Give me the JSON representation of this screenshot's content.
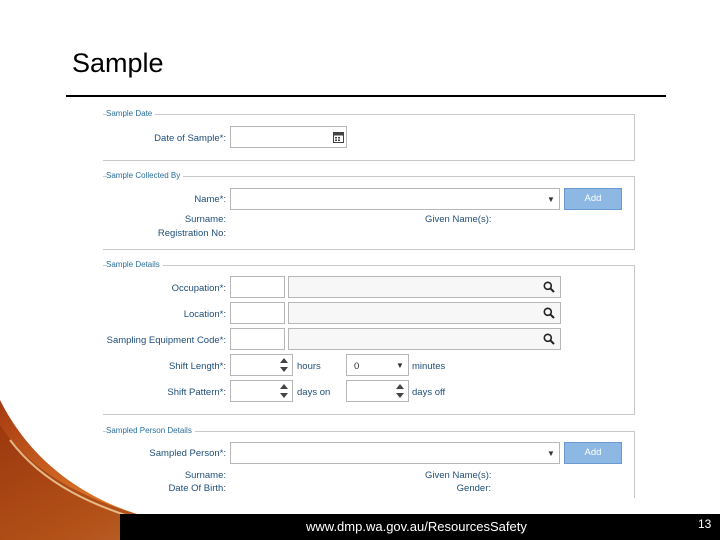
{
  "slide": {
    "title": "Sample",
    "footer_url": "www.dmp.wa.gov.au/ResourcesSafety",
    "page_number": "13"
  },
  "sections": {
    "sample_date": {
      "legend": "Sample Date",
      "date_label": "Date of Sample*:"
    },
    "collected_by": {
      "legend": "Sample Collected By",
      "name_label": "Name*:",
      "add_label": "Add",
      "surname_label": "Surname:",
      "given_label": "Given Name(s):",
      "registration_label": "Registration No:"
    },
    "details": {
      "legend": "Sample Details",
      "occupation_label": "Occupation*:",
      "location_label": "Location*:",
      "equipment_label": "Sampling Equipment Code*:",
      "shift_length_label": "Shift Length*:",
      "hours_label": "hours",
      "minutes_value": "0",
      "minutes_label": "minutes",
      "shift_pattern_label": "Shift Pattern*:",
      "days_on_label": "days on",
      "days_off_label": "days off"
    },
    "person": {
      "legend": "Sampled Person Details",
      "person_label": "Sampled Person*:",
      "add_label": "Add",
      "surname_label": "Surname:",
      "given_label": "Given Name(s):",
      "dob_label": "Date Of Birth:",
      "gender_label": "Gender:"
    }
  },
  "icons": {
    "calendar": "calendar-icon",
    "search": "search-icon",
    "dropdown": "chevron-down-icon",
    "spinner": "spinner-arrows-icon"
  },
  "colors": {
    "label": "#1f4e79",
    "legend": "#2a6f9b",
    "button": "#8db8e3",
    "footer": "#000000",
    "swoosh": "#c8511b"
  }
}
